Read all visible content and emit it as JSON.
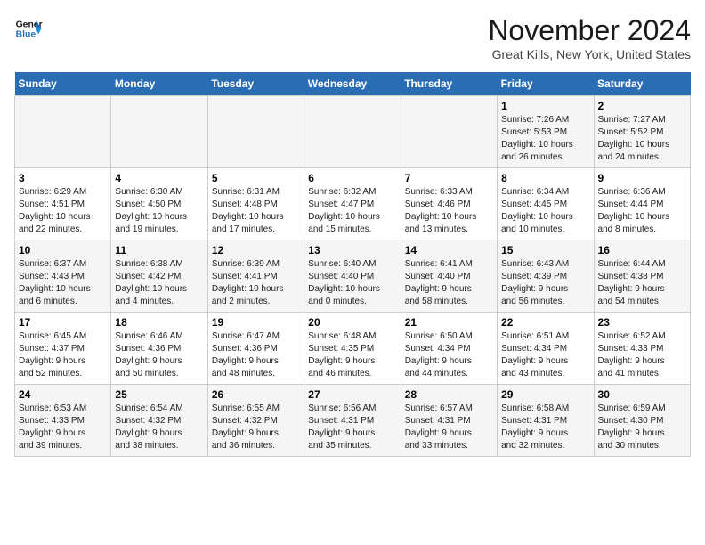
{
  "header": {
    "logo_line1": "General",
    "logo_line2": "Blue",
    "month": "November 2024",
    "location": "Great Kills, New York, United States"
  },
  "weekdays": [
    "Sunday",
    "Monday",
    "Tuesday",
    "Wednesday",
    "Thursday",
    "Friday",
    "Saturday"
  ],
  "weeks": [
    [
      {
        "day": "",
        "info": ""
      },
      {
        "day": "",
        "info": ""
      },
      {
        "day": "",
        "info": ""
      },
      {
        "day": "",
        "info": ""
      },
      {
        "day": "",
        "info": ""
      },
      {
        "day": "1",
        "info": "Sunrise: 7:26 AM\nSunset: 5:53 PM\nDaylight: 10 hours\nand 26 minutes."
      },
      {
        "day": "2",
        "info": "Sunrise: 7:27 AM\nSunset: 5:52 PM\nDaylight: 10 hours\nand 24 minutes."
      }
    ],
    [
      {
        "day": "3",
        "info": "Sunrise: 6:29 AM\nSunset: 4:51 PM\nDaylight: 10 hours\nand 22 minutes."
      },
      {
        "day": "4",
        "info": "Sunrise: 6:30 AM\nSunset: 4:50 PM\nDaylight: 10 hours\nand 19 minutes."
      },
      {
        "day": "5",
        "info": "Sunrise: 6:31 AM\nSunset: 4:48 PM\nDaylight: 10 hours\nand 17 minutes."
      },
      {
        "day": "6",
        "info": "Sunrise: 6:32 AM\nSunset: 4:47 PM\nDaylight: 10 hours\nand 15 minutes."
      },
      {
        "day": "7",
        "info": "Sunrise: 6:33 AM\nSunset: 4:46 PM\nDaylight: 10 hours\nand 13 minutes."
      },
      {
        "day": "8",
        "info": "Sunrise: 6:34 AM\nSunset: 4:45 PM\nDaylight: 10 hours\nand 10 minutes."
      },
      {
        "day": "9",
        "info": "Sunrise: 6:36 AM\nSunset: 4:44 PM\nDaylight: 10 hours\nand 8 minutes."
      }
    ],
    [
      {
        "day": "10",
        "info": "Sunrise: 6:37 AM\nSunset: 4:43 PM\nDaylight: 10 hours\nand 6 minutes."
      },
      {
        "day": "11",
        "info": "Sunrise: 6:38 AM\nSunset: 4:42 PM\nDaylight: 10 hours\nand 4 minutes."
      },
      {
        "day": "12",
        "info": "Sunrise: 6:39 AM\nSunset: 4:41 PM\nDaylight: 10 hours\nand 2 minutes."
      },
      {
        "day": "13",
        "info": "Sunrise: 6:40 AM\nSunset: 4:40 PM\nDaylight: 10 hours\nand 0 minutes."
      },
      {
        "day": "14",
        "info": "Sunrise: 6:41 AM\nSunset: 4:40 PM\nDaylight: 9 hours\nand 58 minutes."
      },
      {
        "day": "15",
        "info": "Sunrise: 6:43 AM\nSunset: 4:39 PM\nDaylight: 9 hours\nand 56 minutes."
      },
      {
        "day": "16",
        "info": "Sunrise: 6:44 AM\nSunset: 4:38 PM\nDaylight: 9 hours\nand 54 minutes."
      }
    ],
    [
      {
        "day": "17",
        "info": "Sunrise: 6:45 AM\nSunset: 4:37 PM\nDaylight: 9 hours\nand 52 minutes."
      },
      {
        "day": "18",
        "info": "Sunrise: 6:46 AM\nSunset: 4:36 PM\nDaylight: 9 hours\nand 50 minutes."
      },
      {
        "day": "19",
        "info": "Sunrise: 6:47 AM\nSunset: 4:36 PM\nDaylight: 9 hours\nand 48 minutes."
      },
      {
        "day": "20",
        "info": "Sunrise: 6:48 AM\nSunset: 4:35 PM\nDaylight: 9 hours\nand 46 minutes."
      },
      {
        "day": "21",
        "info": "Sunrise: 6:50 AM\nSunset: 4:34 PM\nDaylight: 9 hours\nand 44 minutes."
      },
      {
        "day": "22",
        "info": "Sunrise: 6:51 AM\nSunset: 4:34 PM\nDaylight: 9 hours\nand 43 minutes."
      },
      {
        "day": "23",
        "info": "Sunrise: 6:52 AM\nSunset: 4:33 PM\nDaylight: 9 hours\nand 41 minutes."
      }
    ],
    [
      {
        "day": "24",
        "info": "Sunrise: 6:53 AM\nSunset: 4:33 PM\nDaylight: 9 hours\nand 39 minutes."
      },
      {
        "day": "25",
        "info": "Sunrise: 6:54 AM\nSunset: 4:32 PM\nDaylight: 9 hours\nand 38 minutes."
      },
      {
        "day": "26",
        "info": "Sunrise: 6:55 AM\nSunset: 4:32 PM\nDaylight: 9 hours\nand 36 minutes."
      },
      {
        "day": "27",
        "info": "Sunrise: 6:56 AM\nSunset: 4:31 PM\nDaylight: 9 hours\nand 35 minutes."
      },
      {
        "day": "28",
        "info": "Sunrise: 6:57 AM\nSunset: 4:31 PM\nDaylight: 9 hours\nand 33 minutes."
      },
      {
        "day": "29",
        "info": "Sunrise: 6:58 AM\nSunset: 4:31 PM\nDaylight: 9 hours\nand 32 minutes."
      },
      {
        "day": "30",
        "info": "Sunrise: 6:59 AM\nSunset: 4:30 PM\nDaylight: 9 hours\nand 30 minutes."
      }
    ]
  ]
}
